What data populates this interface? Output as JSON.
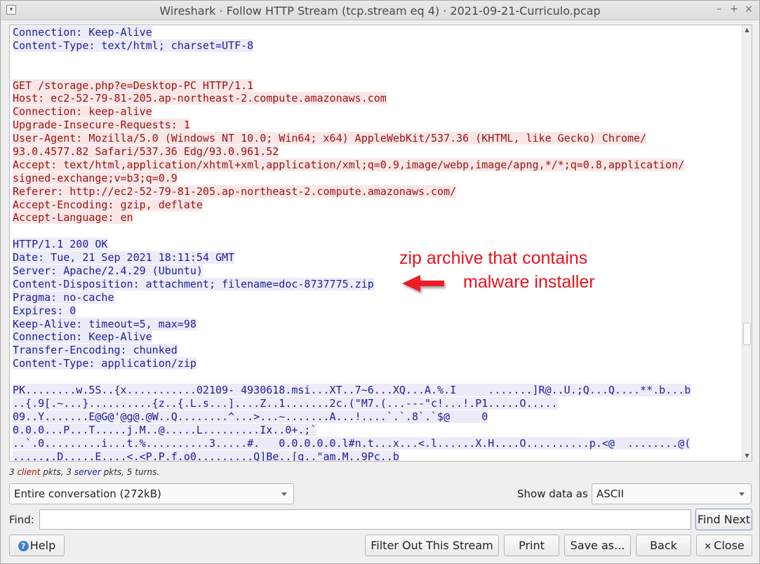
{
  "window": {
    "title": "Wireshark · Follow HTTP Stream (tcp.stream eq 4) · 2021-09-21-Curriculo.pcap",
    "controls": [
      "–",
      "+",
      "×"
    ]
  },
  "stream_lines": [
    {
      "dir": "srv",
      "text": "Connection: Keep-Alive"
    },
    {
      "dir": "srv",
      "text": "Content-Type: text/html; charset=UTF-8"
    },
    {
      "dir": "none",
      "text": ""
    },
    {
      "dir": "none",
      "text": ""
    },
    {
      "dir": "cli",
      "text": "GET /storage.php?e=Desktop-PC HTTP/1.1"
    },
    {
      "dir": "cli",
      "text": "Host: ec2-52-79-81-205.ap-northeast-2.compute.amazonaws.com"
    },
    {
      "dir": "cli",
      "text": "Connection: keep-alive"
    },
    {
      "dir": "cli",
      "text": "Upgrade-Insecure-Requests: 1"
    },
    {
      "dir": "cli",
      "text": "User-Agent: Mozilla/5.0 (Windows NT 10.0; Win64; x64) AppleWebKit/537.36 (KHTML, like Gecko) Chrome/"
    },
    {
      "dir": "cli",
      "text": "93.0.4577.82 Safari/537.36 Edg/93.0.961.52"
    },
    {
      "dir": "cli",
      "text": "Accept: text/html,application/xhtml+xml,application/xml;q=0.9,image/webp,image/apng,*/*;q=0.8,application/"
    },
    {
      "dir": "cli",
      "text": "signed-exchange;v=b3;q=0.9"
    },
    {
      "dir": "cli",
      "text": "Referer: http://ec2-52-79-81-205.ap-northeast-2.compute.amazonaws.com/"
    },
    {
      "dir": "cli",
      "text": "Accept-Encoding: gzip, deflate"
    },
    {
      "dir": "cli",
      "text": "Accept-Language: en"
    },
    {
      "dir": "none",
      "text": ""
    },
    {
      "dir": "srv",
      "text": "HTTP/1.1 200 OK"
    },
    {
      "dir": "srv",
      "text": "Date: Tue, 21 Sep 2021 18:11:54 GMT"
    },
    {
      "dir": "srv",
      "text": "Server: Apache/2.4.29 (Ubuntu)"
    },
    {
      "dir": "srv",
      "text": "Content-Disposition: attachment; filename=doc-8737775.zip"
    },
    {
      "dir": "srv",
      "text": "Pragma: no-cache"
    },
    {
      "dir": "srv",
      "text": "Expires: 0"
    },
    {
      "dir": "srv",
      "text": "Keep-Alive: timeout=5, max=98"
    },
    {
      "dir": "srv",
      "text": "Connection: Keep-Alive"
    },
    {
      "dir": "srv",
      "text": "Transfer-Encoding: chunked"
    },
    {
      "dir": "srv",
      "text": "Content-Type: application/zip"
    },
    {
      "dir": "none",
      "text": ""
    },
    {
      "dir": "srv",
      "text": "PK........w.5S..{x...........02109- 4930618.msi...XT..7~6...XQ...A.%.I     .......]R@..U.;Q...Q....**.b...b"
    },
    {
      "dir": "srv",
      "text": "..{.9[.~...}..........{z..{.L.s...]....Z..1.......2c.(\"M7.(...---\"c!...!.P1.....O....."
    },
    {
      "dir": "srv",
      "text": "09..Y.......E@G@'@g@.@W..Q........^...>...~.......A...!....`.`.8`.`$@     0"
    },
    {
      "dir": "srv",
      "text": "0.0.0...P...T.....j.M..@.....L.........Ix..0+.;`"
    },
    {
      "dir": "srv",
      "text": "..`.0.........i...t.%..........3.....#.   0.0.0.0.0.l#n.t...x...<.l......X.H....O..........p.<@  ........@("
    },
    {
      "dir": "srv",
      "text": ".....,.D.....E....<.<P.P.f.o0.........Q]Be..[g..\"am.M..9Pc..b"
    }
  ],
  "annotation": {
    "line1": "zip archive that contains",
    "line2": "malware installer",
    "color": "#e8121b"
  },
  "status": {
    "prefix": "3 ",
    "client": "client",
    "mid": " pkts, 3 ",
    "server": "server",
    "suffix": " pkts, 5 turns."
  },
  "controls": {
    "conversation_select": "Entire conversation (272kB)",
    "show_data_label": "Show data as",
    "show_data_select": "ASCII",
    "find_label": "Find:",
    "find_value": "",
    "find_next": "Find Next"
  },
  "buttons": {
    "help": "Help",
    "filter_out": "Filter Out This Stream",
    "print": "Print",
    "save_as": "Save as...",
    "back": "Back",
    "close": "Close"
  },
  "colors": {
    "client_fg": "#9b1111",
    "client_bg": "#f9e7e7",
    "server_fg": "#1d1d9a",
    "server_bg": "#ececf8"
  }
}
